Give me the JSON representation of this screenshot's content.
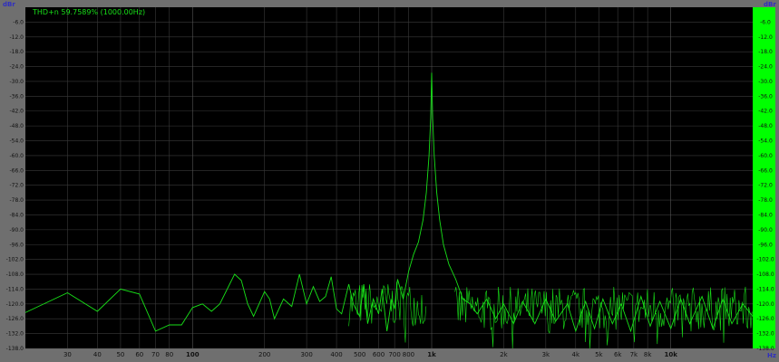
{
  "chart_data": {
    "type": "line",
    "title": "THD+n 59.7589% (1000.00Hz)",
    "ylabel_left": "dBr",
    "ylabel_right": "dBr",
    "xlabel": "Hz",
    "x_scale": "log",
    "xlim": [
      20,
      22000
    ],
    "ylim": [
      -138,
      0
    ],
    "y_ticks": [
      "-6.0",
      "-12.0",
      "-18.0",
      "-24.0",
      "-30.0",
      "-36.0",
      "-42.0",
      "-48.0",
      "-54.0",
      "-60.0",
      "-66.0",
      "-72.0",
      "-78.0",
      "-84.0",
      "-90.0",
      "-96.0",
      "-102.0",
      "-108.0",
      "-114.0",
      "-120.0",
      "-126.0",
      "-132.0",
      "-138.0"
    ],
    "x_ticks": [
      {
        "v": 30,
        "label": "30"
      },
      {
        "v": 40,
        "label": "40"
      },
      {
        "v": 50,
        "label": "50"
      },
      {
        "v": 60,
        "label": "60"
      },
      {
        "v": 70,
        "label": "70"
      },
      {
        "v": 80,
        "label": "80"
      },
      {
        "v": 100,
        "label": "100",
        "bold": true
      },
      {
        "v": 200,
        "label": "200"
      },
      {
        "v": 300,
        "label": "300"
      },
      {
        "v": 400,
        "label": "400"
      },
      {
        "v": 500,
        "label": "500"
      },
      {
        "v": 600,
        "label": "600"
      },
      {
        "v": 700,
        "label": "700"
      },
      {
        "v": 800,
        "label": "800"
      },
      {
        "v": 1000,
        "label": "1k",
        "bold": true
      },
      {
        "v": 2000,
        "label": "2k"
      },
      {
        "v": 3000,
        "label": "3k"
      },
      {
        "v": 4000,
        "label": "4k"
      },
      {
        "v": 5000,
        "label": "5k"
      },
      {
        "v": 6000,
        "label": "6k"
      },
      {
        "v": 7000,
        "label": "7k"
      },
      {
        "v": 8000,
        "label": "8k"
      },
      {
        "v": 10000,
        "label": "10k",
        "bold": true
      }
    ],
    "series": [
      {
        "color": "#18e018",
        "points": [
          [
            20,
            -123.5
          ],
          [
            30,
            -115.5
          ],
          [
            40,
            -123
          ],
          [
            50,
            -114
          ],
          [
            60,
            -116
          ],
          [
            70,
            -131
          ],
          [
            80,
            -128.5
          ],
          [
            90,
            -128.5
          ],
          [
            100,
            -121.5
          ],
          [
            110,
            -120
          ],
          [
            120,
            -123
          ],
          [
            130,
            -120
          ],
          [
            150,
            -108
          ],
          [
            160,
            -110.5
          ],
          [
            170,
            -120
          ],
          [
            180,
            -125
          ],
          [
            200,
            -115
          ],
          [
            210,
            -118
          ],
          [
            220,
            -126
          ],
          [
            240,
            -118
          ],
          [
            260,
            -121
          ],
          [
            280,
            -108
          ],
          [
            300,
            -120
          ],
          [
            320,
            -113
          ],
          [
            340,
            -119
          ],
          [
            360,
            -117
          ],
          [
            380,
            -109
          ],
          [
            400,
            -122
          ],
          [
            420,
            -124
          ],
          [
            450,
            -112
          ],
          [
            470,
            -120
          ],
          [
            500,
            -125
          ],
          [
            520,
            -112
          ],
          [
            540,
            -128
          ],
          [
            570,
            -118
          ],
          [
            600,
            -124
          ],
          [
            620,
            -114
          ],
          [
            650,
            -131
          ],
          [
            680,
            -118
          ],
          [
            700,
            -122
          ],
          [
            720,
            -110
          ],
          [
            760,
            -118
          ],
          [
            800,
            -107
          ],
          [
            840,
            -100
          ],
          [
            880,
            -95
          ],
          [
            920,
            -86
          ],
          [
            950,
            -75
          ],
          [
            975,
            -60
          ],
          [
            990,
            -45
          ],
          [
            1000,
            -26.5
          ],
          [
            1010,
            -45
          ],
          [
            1025,
            -60
          ],
          [
            1050,
            -75
          ],
          [
            1080,
            -86
          ],
          [
            1120,
            -96
          ],
          [
            1180,
            -104
          ],
          [
            1260,
            -110
          ],
          [
            1350,
            -118
          ],
          [
            1450,
            -120
          ],
          [
            1550,
            -124
          ],
          [
            1700,
            -118
          ],
          [
            1850,
            -126
          ],
          [
            2000,
            -120
          ],
          [
            2200,
            -128
          ],
          [
            2400,
            -119
          ],
          [
            2700,
            -128
          ],
          [
            3000,
            -118
          ],
          [
            3300,
            -127
          ],
          [
            3700,
            -120
          ],
          [
            4000,
            -131
          ],
          [
            4400,
            -119
          ],
          [
            4800,
            -130
          ],
          [
            5200,
            -118
          ],
          [
            5700,
            -128
          ],
          [
            6200,
            -120
          ],
          [
            6800,
            -131
          ],
          [
            7500,
            -117
          ],
          [
            8200,
            -129
          ],
          [
            9000,
            -119
          ],
          [
            10000,
            -130
          ],
          [
            11000,
            -118
          ],
          [
            12000,
            -128
          ],
          [
            13500,
            -117
          ],
          [
            15000,
            -130
          ],
          [
            16500,
            -118
          ],
          [
            18000,
            -128
          ],
          [
            20000,
            -120
          ],
          [
            22000,
            -125
          ]
        ]
      }
    ],
    "noise_bands": [
      {
        "from": 450,
        "to": 950,
        "center": -120,
        "amp": 9
      },
      {
        "from": 1250,
        "to": 22000,
        "center": -122,
        "amp": 9
      }
    ],
    "grid": true,
    "colors": {
      "background": "#000000",
      "frame": "#6f6f6f",
      "grid": "#3a3a3a",
      "trace": "#18e018",
      "title_text": "#18e018",
      "right_axis_bg": "#00ff00",
      "axis_label": "#3030c0"
    }
  }
}
